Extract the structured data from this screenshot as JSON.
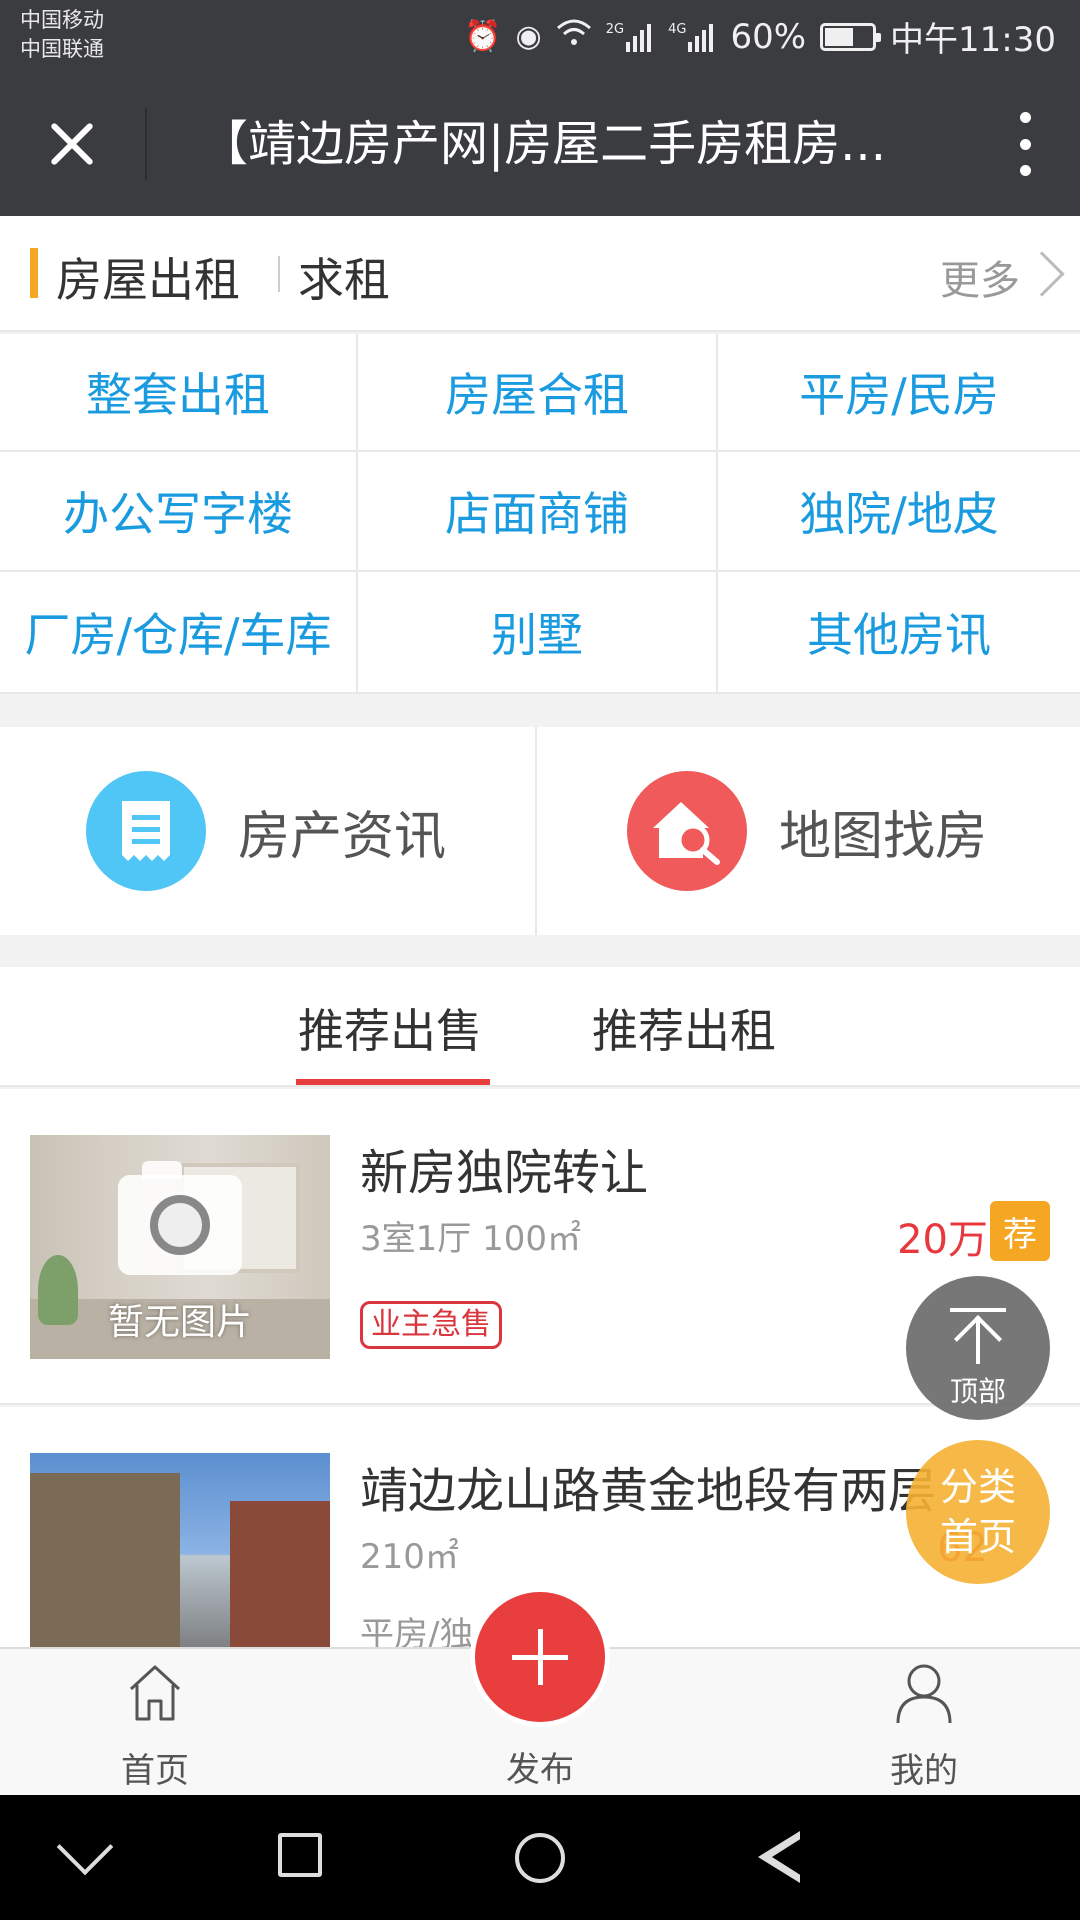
{
  "status_bar": {
    "carrier_1": "中国移动",
    "carrier_2": "中国联通",
    "network_2g": "2G",
    "network_4g": "4G",
    "battery": "60%",
    "battery_level": 0.6,
    "time": "中午11:30"
  },
  "title_bar": {
    "title": "【靖边房产网|房屋二手房租房..."
  },
  "rent_section": {
    "tab_rent": "房屋出租",
    "tab_seek": "求租",
    "more": "更多"
  },
  "categories": [
    "整套出租",
    "房屋合租",
    "平房/民房",
    "办公写字楼",
    "店面商铺",
    "独院/地皮",
    "厂房/仓库/车库",
    "别墅",
    "其他房讯"
  ],
  "features": {
    "news": "房产资讯",
    "map": "地图找房"
  },
  "recommend_tabs": {
    "sale": "推荐出售",
    "rent": "推荐出租",
    "active": "sale"
  },
  "listings": [
    {
      "title": "新房独院转让",
      "meta": "3室1厅  100㎡",
      "price": "20万",
      "badge": "荐",
      "tag": "业主急售",
      "image_text": "暂无图片"
    },
    {
      "title": "靖边龙山路黄金地段有两层",
      "meta": "210㎡",
      "price": "62",
      "sub": "平房/独"
    }
  ],
  "floating": {
    "top": "顶部",
    "category_line1": "分类",
    "category_line2": "首页"
  },
  "bottom_nav": {
    "home": "首页",
    "publish": "发布",
    "me": "我的"
  },
  "colors": {
    "header_bg": "#3a3c3f",
    "accent_orange": "#f5a623",
    "category_blue": "#1a9be0",
    "price_red": "#e8383d",
    "publish_red": "#e83e3e"
  }
}
